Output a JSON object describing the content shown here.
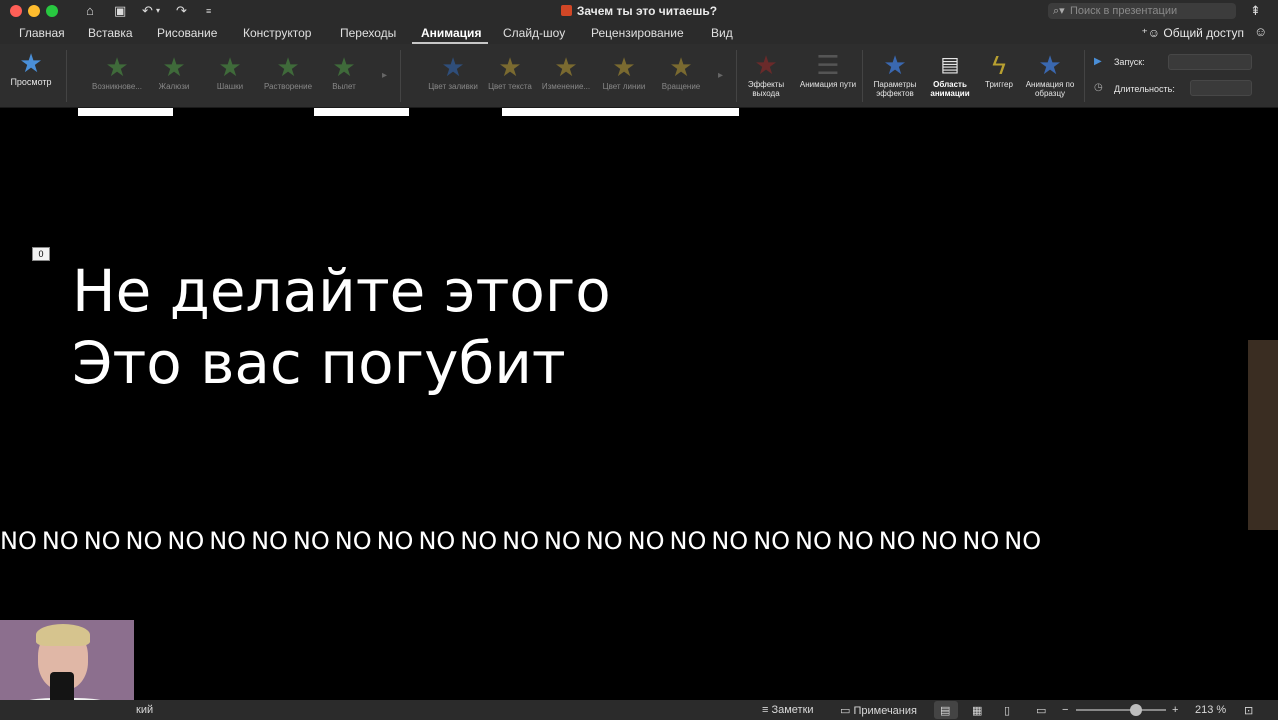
{
  "window": {
    "title": "Зачем ты это читаешь?",
    "search_placeholder": "Поиск в презентации"
  },
  "tabs": [
    "Главная",
    "Вставка",
    "Рисование",
    "Конструктор",
    "Переходы",
    "Анимация",
    "Слайд-шоу",
    "Рецензирование",
    "Вид"
  ],
  "share_label": "Общий доступ",
  "ribbon": {
    "preview": "Просмотр",
    "entrance_effects": [
      "Возникнове...",
      "Жалюзи",
      "Шашки",
      "Растворение",
      "Вылет"
    ],
    "emphasis_effects": [
      "Цвет заливки",
      "Цвет текста",
      "Изменение...",
      "Цвет линии",
      "Вращение"
    ],
    "exit_effects": "Эффекты выхода",
    "motion_path": "Анимация пути",
    "effect_options": "Параметры эффектов",
    "animation_pane": "Область анимации",
    "trigger": "Триггер",
    "animation_painter": "Анимация по образцу",
    "start_label": "Запуск:",
    "duration_label": "Длительность:",
    "start_value": "",
    "duration_value": ""
  },
  "slide": {
    "animation_badge": "0",
    "line1": "Не делайте этого",
    "line2": "Это вас погубит",
    "repeat_word": "NO",
    "repeat_count": 25
  },
  "statusbar": {
    "language": "кий",
    "notes": "Заметки",
    "comments": "Примечания",
    "zoom": "213 %"
  }
}
